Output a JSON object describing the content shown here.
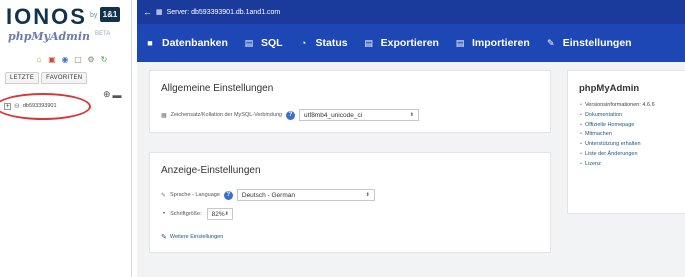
{
  "brand": {
    "ionos": "IONOS",
    "by": "by",
    "box": "1&1",
    "pma": "phpMyAdmin",
    "pma_sup": "BETA"
  },
  "sidebar": {
    "nav_icons": [
      {
        "name": "home-icon",
        "glyph": "⌂",
        "color": "#c4901c"
      },
      {
        "name": "logout-icon",
        "glyph": "▣",
        "color": "#c94c2e"
      },
      {
        "name": "docs-icon",
        "glyph": "◉",
        "color": "#3b6fd0"
      },
      {
        "name": "info-icon",
        "glyph": "▢",
        "color": "#7c7c7c"
      },
      {
        "name": "settings-icon",
        "glyph": "⚙",
        "color": "#6f8f6f"
      },
      {
        "name": "reload-icon",
        "glyph": "↻",
        "color": "#3c9a3c"
      }
    ],
    "tabs": [
      {
        "label": "LETZTE"
      },
      {
        "label": "FAVORITEN"
      }
    ],
    "server_label": "db593393901"
  },
  "breadcrumb": {
    "text": "Server: db593393901.db.1and1.com"
  },
  "menu": {
    "items": [
      {
        "icon": "■",
        "label": "Datenbanken",
        "name": "menu-datenbanken"
      },
      {
        "icon": "▤",
        "label": "SQL",
        "name": "menu-sql"
      },
      {
        "icon": "◔",
        "label": "Status",
        "name": "menu-status"
      },
      {
        "icon": "▤",
        "label": "Exportieren",
        "name": "menu-exportieren"
      },
      {
        "icon": "▤",
        "label": "Importieren",
        "name": "menu-importieren"
      },
      {
        "icon": "✎",
        "label": "Einstellungen",
        "name": "menu-einstellungen"
      }
    ]
  },
  "general": {
    "title": "Allgemeine Einstellungen",
    "collation_label": "Zeichensatz/Kollation der MySQL-Verbindung",
    "collation_value": "utf8mb4_unicode_ci"
  },
  "display": {
    "title": "Anzeige-Einstellungen",
    "language_label": "Sprache - Language",
    "language_value": "Deutsch - German",
    "fontsize_label": "Schriftgröße:",
    "fontsize_value": "82%",
    "more_settings": "Weitere Einstellungen"
  },
  "pma_panel": {
    "title": "phpMyAdmin",
    "items": [
      {
        "label": "Versionsinformationen: 4.6.6",
        "link": false
      },
      {
        "label": "Dokumentation",
        "link": true
      },
      {
        "label": "Offizielle Homepage",
        "link": true
      },
      {
        "label": "Mitmachen",
        "link": true
      },
      {
        "label": "Unterstützung erhalten",
        "link": true
      },
      {
        "label": "Liste der Änderungen",
        "link": true
      },
      {
        "label": "Lizenz",
        "link": true
      }
    ]
  }
}
